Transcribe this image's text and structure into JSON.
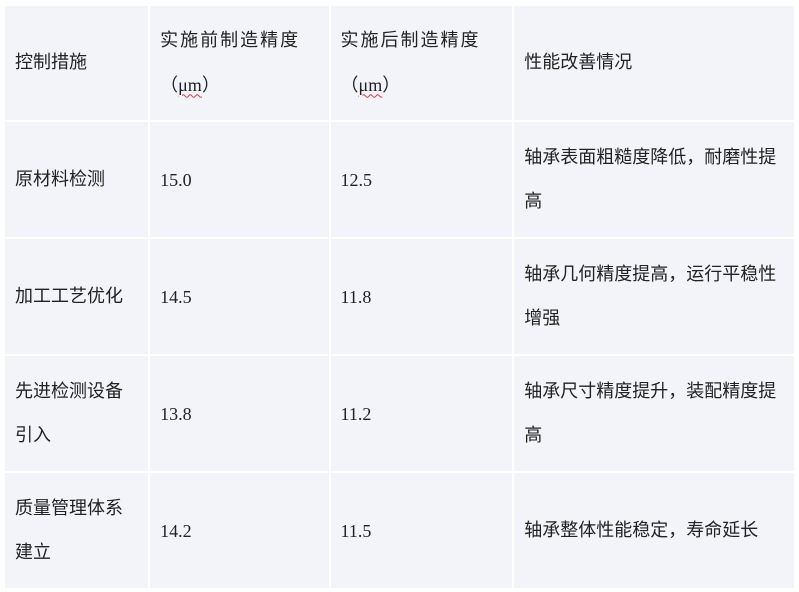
{
  "table": {
    "headers": {
      "measure": "控制措施",
      "before": "实施前制造精度",
      "after": "实施后制造精度",
      "unit_open": "（",
      "unit": "μm",
      "unit_close": "）",
      "improvement": "性能改善情况"
    },
    "rows": [
      {
        "measure": "原材料检测",
        "before": "15.0",
        "after": "12.5",
        "improvement": "轴承表面粗糙度降低，耐磨性提高"
      },
      {
        "measure": "加工工艺优化",
        "before": "14.5",
        "after": "11.8",
        "improvement": "轴承几何精度提高，运行平稳性增强"
      },
      {
        "measure": "先进检测设备引入",
        "before": "13.8",
        "after": "11.2",
        "improvement": "轴承尺寸精度提升，装配精度提高"
      },
      {
        "measure": "质量管理体系建立",
        "before": "14.2",
        "after": "11.5",
        "improvement": "轴承整体性能稳定，寿命延长"
      }
    ]
  }
}
